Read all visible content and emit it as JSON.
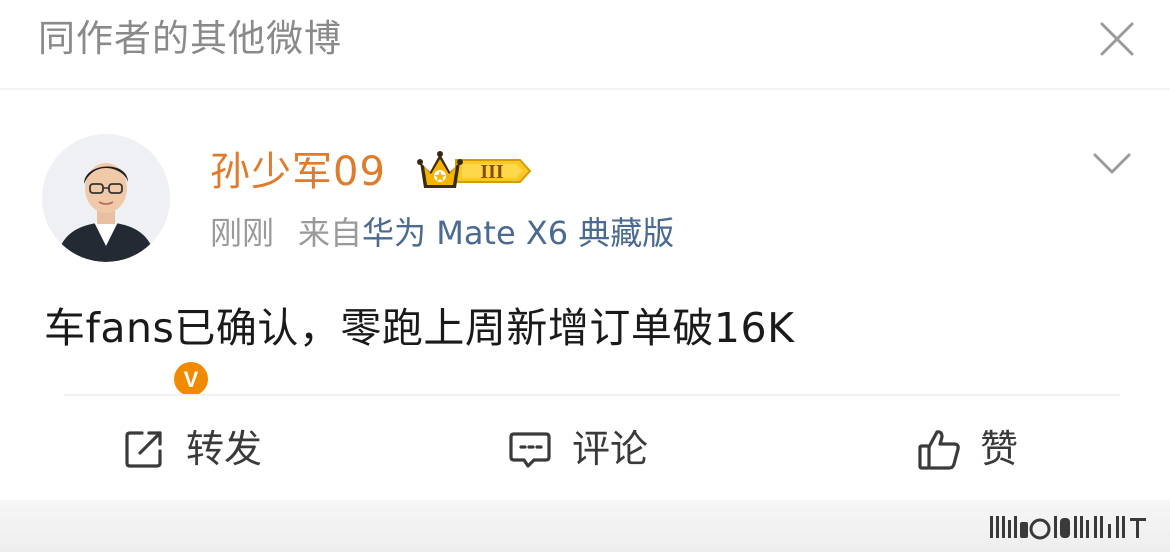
{
  "header": {
    "title": "同作者的其他微博",
    "close_icon": "close-icon"
  },
  "post": {
    "author": {
      "name": "孙少军09",
      "avatar": "avatar",
      "verified_badge": "V",
      "membership_badge_text": "III",
      "membership_icon": "crown-icon"
    },
    "time": "刚刚",
    "source_prefix": "来自",
    "device": "华为 Mate X6 典藏版",
    "menu_icon": "chevron-down-icon",
    "text": "车fans已确认，零跑上周新增订单破16K"
  },
  "actions": {
    "repost_label": "转发",
    "comment_label": "评论",
    "like_label": "赞"
  },
  "colors": {
    "username": "#e07b2b",
    "device_link": "#4a6a92",
    "muted_text": "#9a9a9a",
    "header_text": "#8a8a8a",
    "verified_badge": "#f28a00",
    "crown": "#f5b400"
  }
}
